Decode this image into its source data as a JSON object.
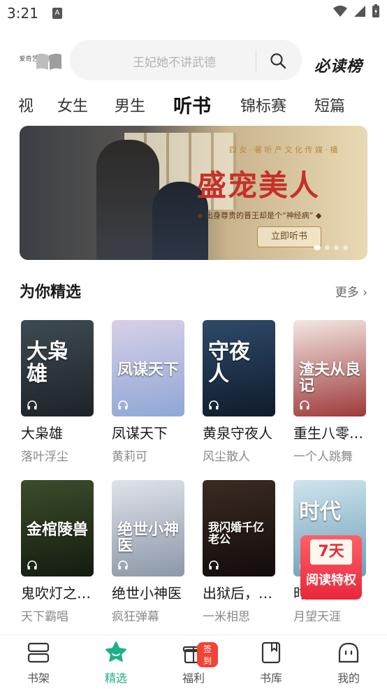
{
  "status_bar": {
    "time": "3:21",
    "notification_glyph": "A"
  },
  "header": {
    "logo_text": "爱奇艺小说",
    "search_placeholder": "王妃她不讲武德",
    "rank_label": "必读榜"
  },
  "tabs": [
    {
      "label": "视",
      "active": false
    },
    {
      "label": "女生",
      "active": false
    },
    {
      "label": "男生",
      "active": false
    },
    {
      "label": "听书",
      "active": true
    },
    {
      "label": "锦标赛",
      "active": false
    },
    {
      "label": "短篇",
      "active": false
    }
  ],
  "banner": {
    "subline": "四 女 · 著    听 产 文 化 传 媒 · 播",
    "title": "盛宠美人",
    "tagline": "◆ 出身尊贵的晋王却是个“神经病” ◆",
    "cta": "立即听书",
    "dots": 4,
    "active_dot": 0
  },
  "section": {
    "title": "为你精选",
    "more": "更多 ›"
  },
  "books": [
    {
      "title": "大枭雄",
      "author": "落叶浮尘",
      "cover_title": "大枭雄",
      "cover_colors": [
        "#3e4a52",
        "#1d2328"
      ]
    },
    {
      "title": "凤谋天下",
      "author": "黄莉可",
      "cover_title": "凤谋天下",
      "cover_colors": [
        "#d8cfe8",
        "#8fa7d6"
      ]
    },
    {
      "title": "黄泉守夜人",
      "author": "风尘散人",
      "cover_title": "守夜人",
      "cover_colors": [
        "#2e4a6a",
        "#0f1b2b"
      ]
    },
    {
      "title": "重生八零…",
      "author": "一个人跳舞",
      "cover_title": "渣夫从良记",
      "cover_colors": [
        "#f3e7e2",
        "#9e3a3a"
      ]
    },
    {
      "title": "鬼吹灯之…",
      "author": "天下霸唱",
      "cover_title": "金棺陵兽",
      "cover_colors": [
        "#3b4d2a",
        "#141b10"
      ]
    },
    {
      "title": "绝世小神医",
      "author": "疯狂弹幕",
      "cover_title": "绝世小神医",
      "cover_colors": [
        "#dfe3ea",
        "#8c97a8"
      ]
    },
    {
      "title": "出狱后，…",
      "author": "一米相思",
      "cover_title": "我闪婚千亿老公",
      "cover_colors": [
        "#3b2a22",
        "#120c0a"
      ]
    },
    {
      "title": "时",
      "author": "月望天涯",
      "cover_title": "时代",
      "cover_colors": [
        "#cfe4ee",
        "#6f9fb8"
      ]
    }
  ],
  "promo": {
    "days": "7天",
    "text": "阅读特权"
  },
  "bottom_nav": [
    {
      "label": "书架",
      "icon": "bookshelf-icon",
      "active": false
    },
    {
      "label": "精选",
      "icon": "star-icon",
      "active": true
    },
    {
      "label": "福利",
      "icon": "gift-icon",
      "active": false,
      "badge": "签到"
    },
    {
      "label": "书库",
      "icon": "library-icon",
      "active": false
    },
    {
      "label": "我的",
      "icon": "profile-icon",
      "active": false
    }
  ],
  "colors": {
    "accent": "#1fb08a",
    "badge": "#f14336",
    "banner_title": "#c6302b"
  }
}
